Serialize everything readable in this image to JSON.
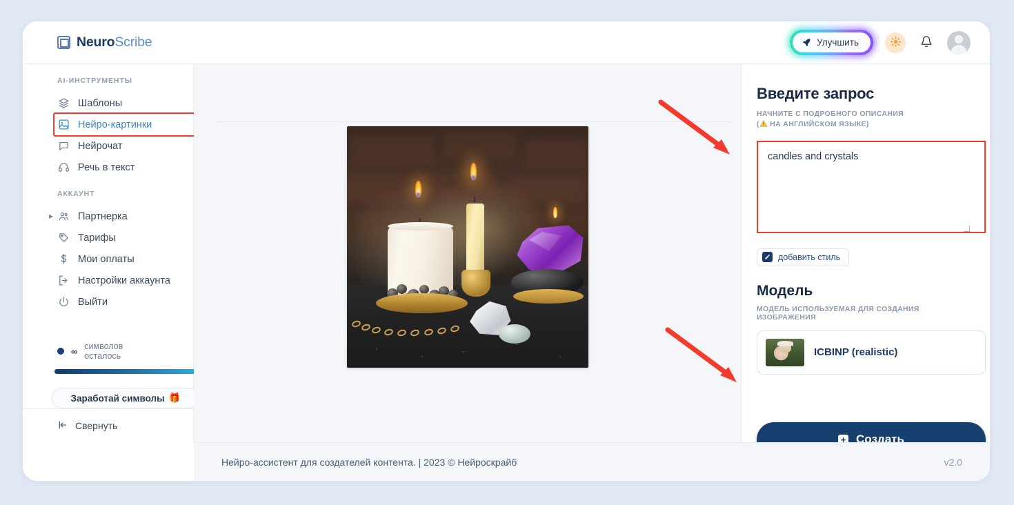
{
  "brand": {
    "part1": "Neuro",
    "part2": "Scribe",
    "icon": "app-logo-icon"
  },
  "header": {
    "upgrade_label": "Улучшить",
    "upgrade_icon": "rocket-icon",
    "theme_icon": "sun-icon",
    "bell_icon": "bell-icon",
    "avatar_icon": "user-avatar-icon"
  },
  "sidebar": {
    "section_tools": "AI-ИНСТРУМЕНТЫ",
    "tools": [
      {
        "label": "Шаблоны",
        "icon": "layers-icon",
        "active": false
      },
      {
        "label": "Нейро-картинки",
        "icon": "image-icon",
        "active": true
      },
      {
        "label": "Нейрочат",
        "icon": "chat-bubble-icon",
        "active": false
      },
      {
        "label": "Речь в текст",
        "icon": "headphones-icon",
        "active": false
      }
    ],
    "section_account": "АККАУНТ",
    "account": [
      {
        "label": "Партнерка",
        "icon": "users-icon",
        "expandable": true
      },
      {
        "label": "Тарифы",
        "icon": "tag-icon",
        "expandable": false
      },
      {
        "label": "Мои оплаты",
        "icon": "dollar-icon",
        "expandable": false
      },
      {
        "label": "Настройки аккаунта",
        "icon": "settings-exit-icon",
        "expandable": false
      },
      {
        "label": "Выйти",
        "icon": "power-icon",
        "expandable": false
      }
    ],
    "quota_symbol": "∞",
    "quota_label": "символов осталось",
    "earn_label": "Заработай символы",
    "earn_emoji": "🎁",
    "collapse_label": "Свернуть",
    "collapse_icon": "collapse-left-icon"
  },
  "center": {
    "generated_image_alt": "candles-and-crystals-generated-image"
  },
  "right": {
    "prompt_title": "Введите запрос",
    "prompt_sub_line1": "НАЧНИТЕ С ПОДРОБНОГО ОПИСАНИЯ",
    "prompt_sub_line2_pre": "(",
    "prompt_sub_line2": "НА АНГЛИЙСКОМ ЯЗЫКЕ)",
    "prompt_value": "candles and crystals",
    "prompt_placeholder": "",
    "style_button": "добавить стиль",
    "style_icon": "pencil-icon",
    "model_title": "Модель",
    "model_sub": "МОДЕЛЬ ИСПОЛЬЗУЕМАЯ ДЛЯ СОЗДАНИЯ ИЗОБРАЖЕНИЯ",
    "model_name": "ICBINP (realistic)",
    "create_label": "Создать",
    "create_icon": "plus-square-icon"
  },
  "footer": {
    "text": "Нейро-ассистент для создателей контента.  | 2023 © Нейроскрайб",
    "version": "v2.0"
  },
  "annotations": {
    "accent_red": "#f53b2e",
    "arrow1_target": "prompt-textarea",
    "arrow2_target": "create-button"
  }
}
